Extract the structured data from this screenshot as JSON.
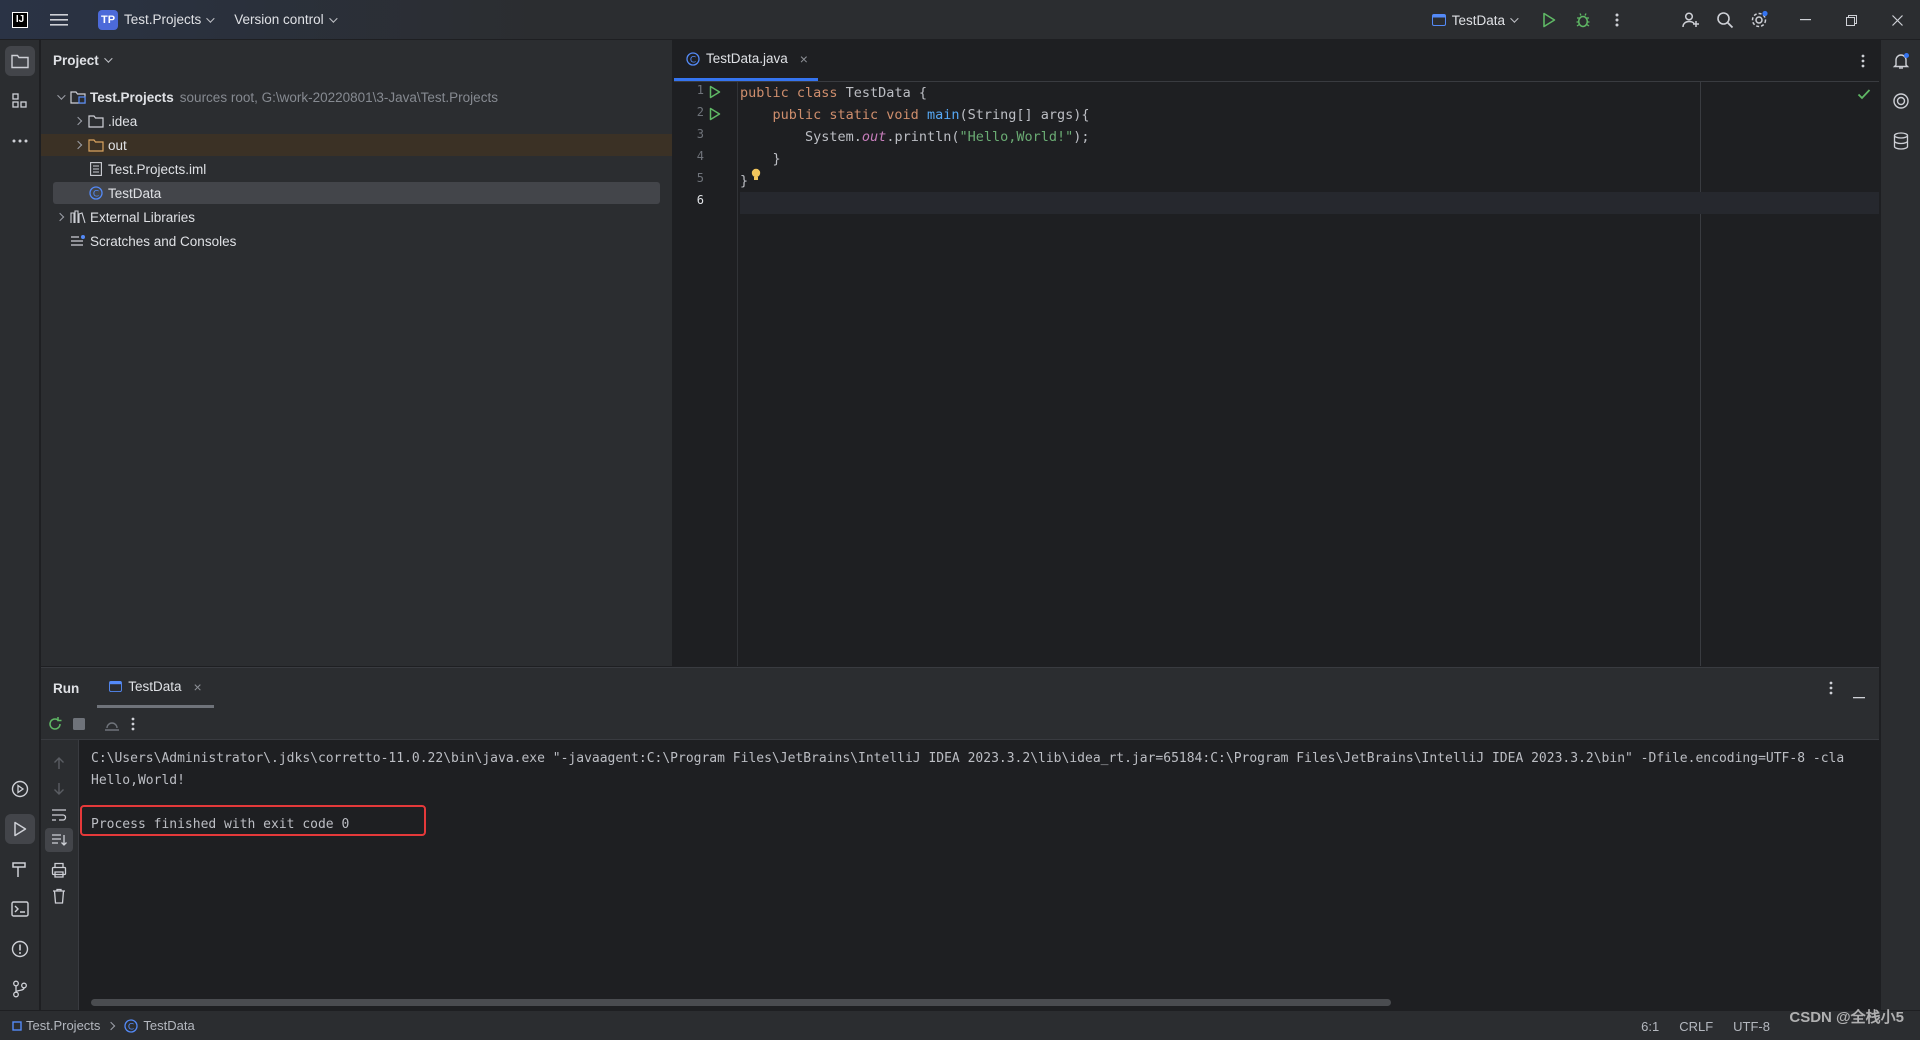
{
  "titlebar": {
    "project_badge": "TP",
    "project_name": "Test.Projects",
    "vcs": "Version control",
    "run_config": "TestData"
  },
  "project_panel": {
    "title": "Project",
    "tree": [
      {
        "label": "Test.Projects",
        "hint": "sources root,  G:\\work-20220801\\3-Java\\Test.Projects"
      },
      {
        "label": ".idea"
      },
      {
        "label": "out"
      },
      {
        "label": "Test.Projects.iml"
      },
      {
        "label": "TestData"
      },
      {
        "label": "External Libraries"
      },
      {
        "label": "Scratches and Consoles"
      }
    ]
  },
  "editor": {
    "tab": "TestData.java",
    "line_numbers": [
      "1",
      "2",
      "3",
      "4",
      "5",
      "6"
    ]
  },
  "run_panel": {
    "title": "Run",
    "tab": "TestData",
    "console": [
      "C:\\Users\\Administrator\\.jdks\\corretto-11.0.22\\bin\\java.exe \"-javaagent:C:\\Program Files\\JetBrains\\IntelliJ IDEA 2023.3.2\\lib\\idea_rt.jar=65184:C:\\Program Files\\JetBrains\\IntelliJ IDEA 2023.3.2\\bin\" -Dfile.encoding=UTF-8 -cla",
      "Hello,World!",
      "",
      "Process finished with exit code 0"
    ]
  },
  "statusbar": {
    "project": "Test.Projects",
    "file": "TestData",
    "position": "6:1",
    "line_sep": "CRLF",
    "encoding": "UTF-8",
    "watermark": "CSDN @全栈小5"
  },
  "colors": {
    "accent": "#3574f0",
    "run_green": "#5fb865",
    "highlight_red": "#e5393a",
    "keyword": "#cf8e6d",
    "string": "#6aab73"
  }
}
